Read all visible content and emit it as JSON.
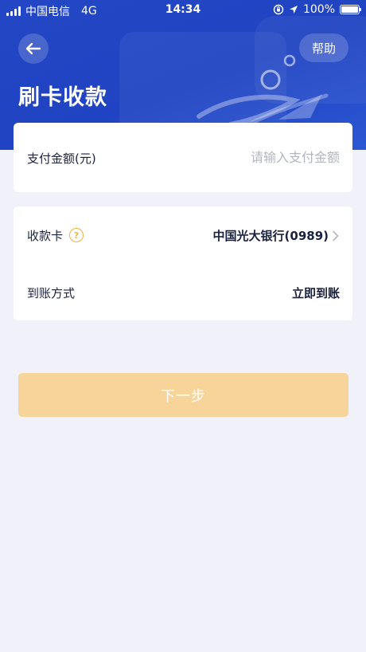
{
  "status_bar": {
    "carrier": "中国电信",
    "network": "4G",
    "time": "14:34",
    "battery": "100%"
  },
  "header": {
    "title": "刷卡收款",
    "help_label": "帮助",
    "back_icon": "arrow-left-icon"
  },
  "amount": {
    "label": "支付金额(元)",
    "placeholder": "请输入支付金额",
    "value": ""
  },
  "receive_card": {
    "label": "收款卡",
    "help_icon_glyph": "?",
    "value": "中国光大银行(0989)"
  },
  "arrival": {
    "label": "到账方式",
    "value": "立即到账"
  },
  "next_button": {
    "label": "下一步"
  },
  "colors": {
    "header_blue": "#2347c4",
    "page_bg": "#f1f2f9",
    "button_disabled": "#f6d49a",
    "accent_orange": "#f0b43a"
  }
}
